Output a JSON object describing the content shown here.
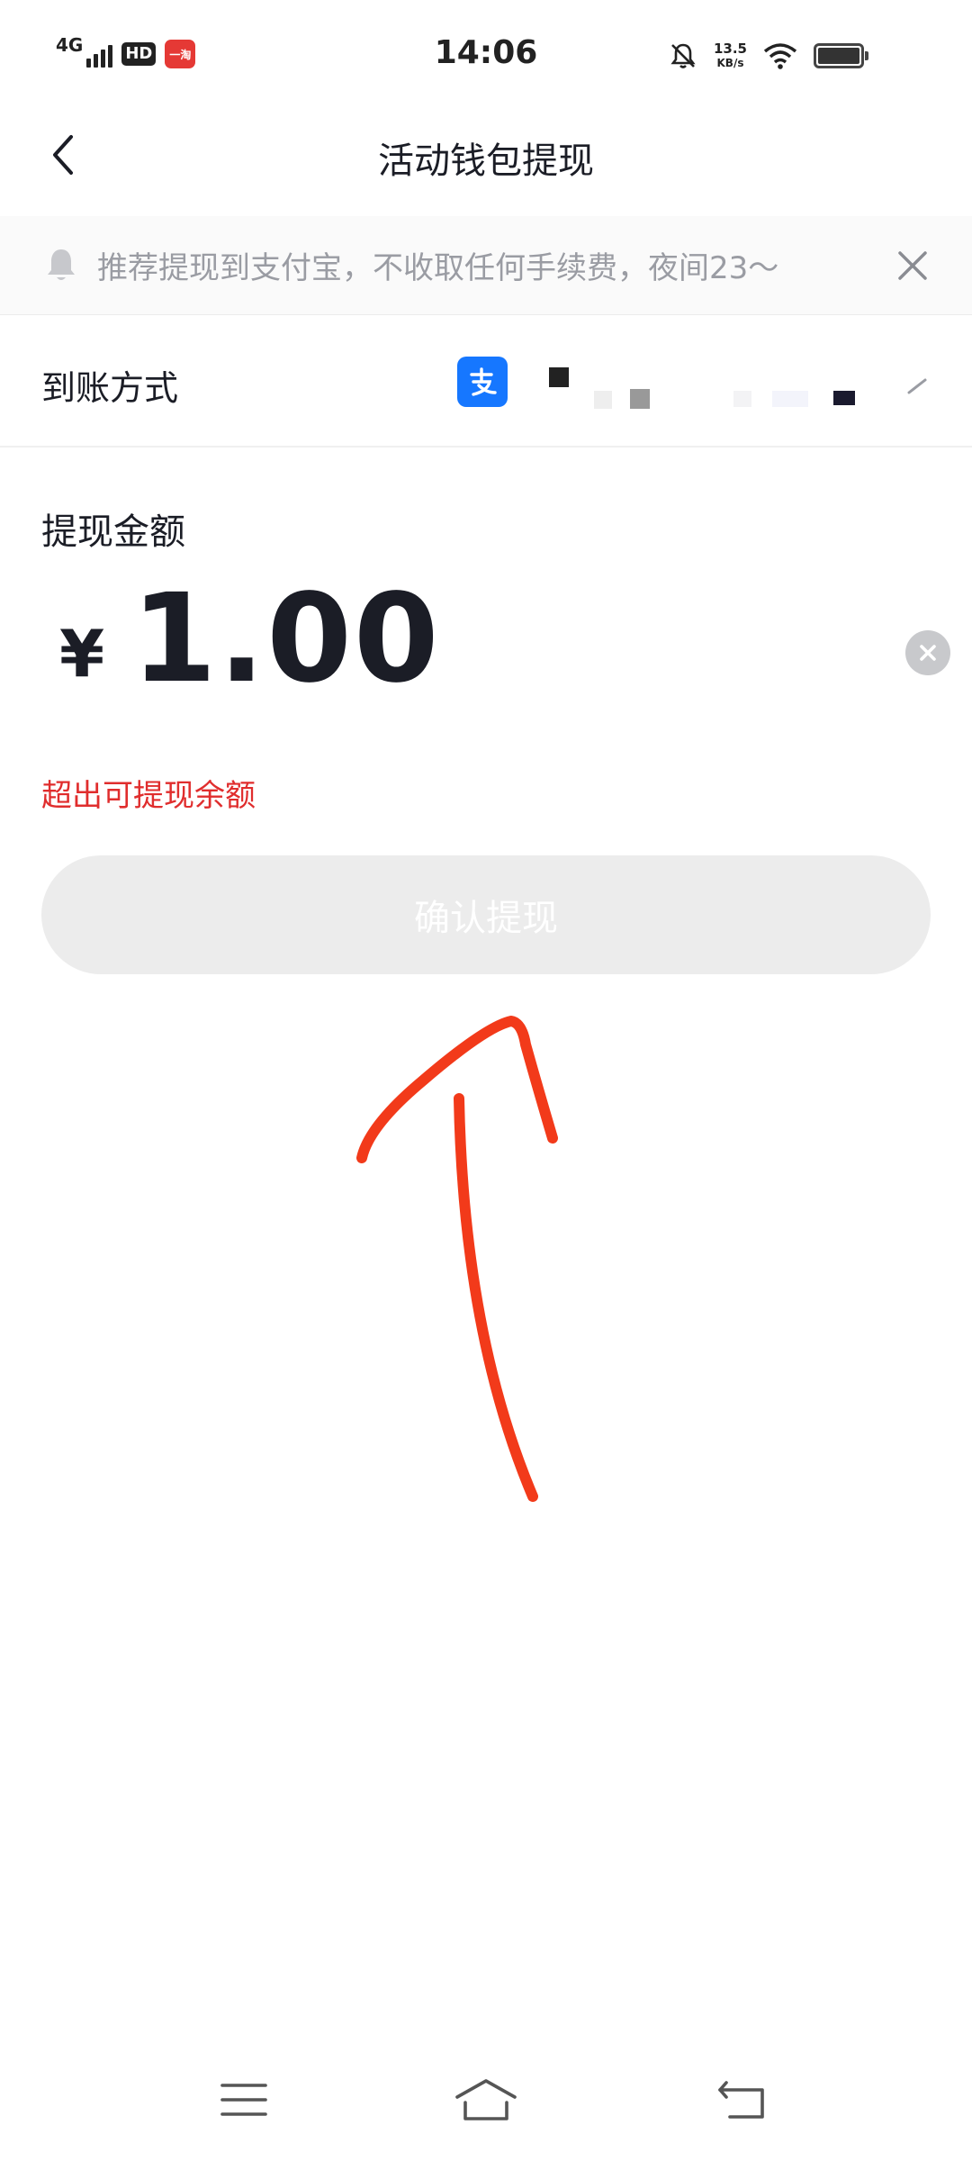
{
  "status_bar": {
    "network": "4G",
    "hd": "HD",
    "app_badge": "一淘",
    "time": "14:06",
    "speed_value": "13.5",
    "speed_unit": "KB/s"
  },
  "header": {
    "title": "活动钱包提现"
  },
  "notice": {
    "text": "推荐提现到支付宝，不收取任何手续费，夜间23～"
  },
  "payout": {
    "label": "到账方式",
    "method_icon": "alipay-icon"
  },
  "amount": {
    "label": "提现金额",
    "currency": "¥",
    "value": "1.00"
  },
  "error": {
    "text": "超出可提现余额"
  },
  "confirm_button": {
    "label": "确认提现"
  },
  "colors": {
    "error": "#e02d2d",
    "button_disabled": "#ececec",
    "alipay": "#1677ff",
    "annotation": "#f23a1a"
  }
}
